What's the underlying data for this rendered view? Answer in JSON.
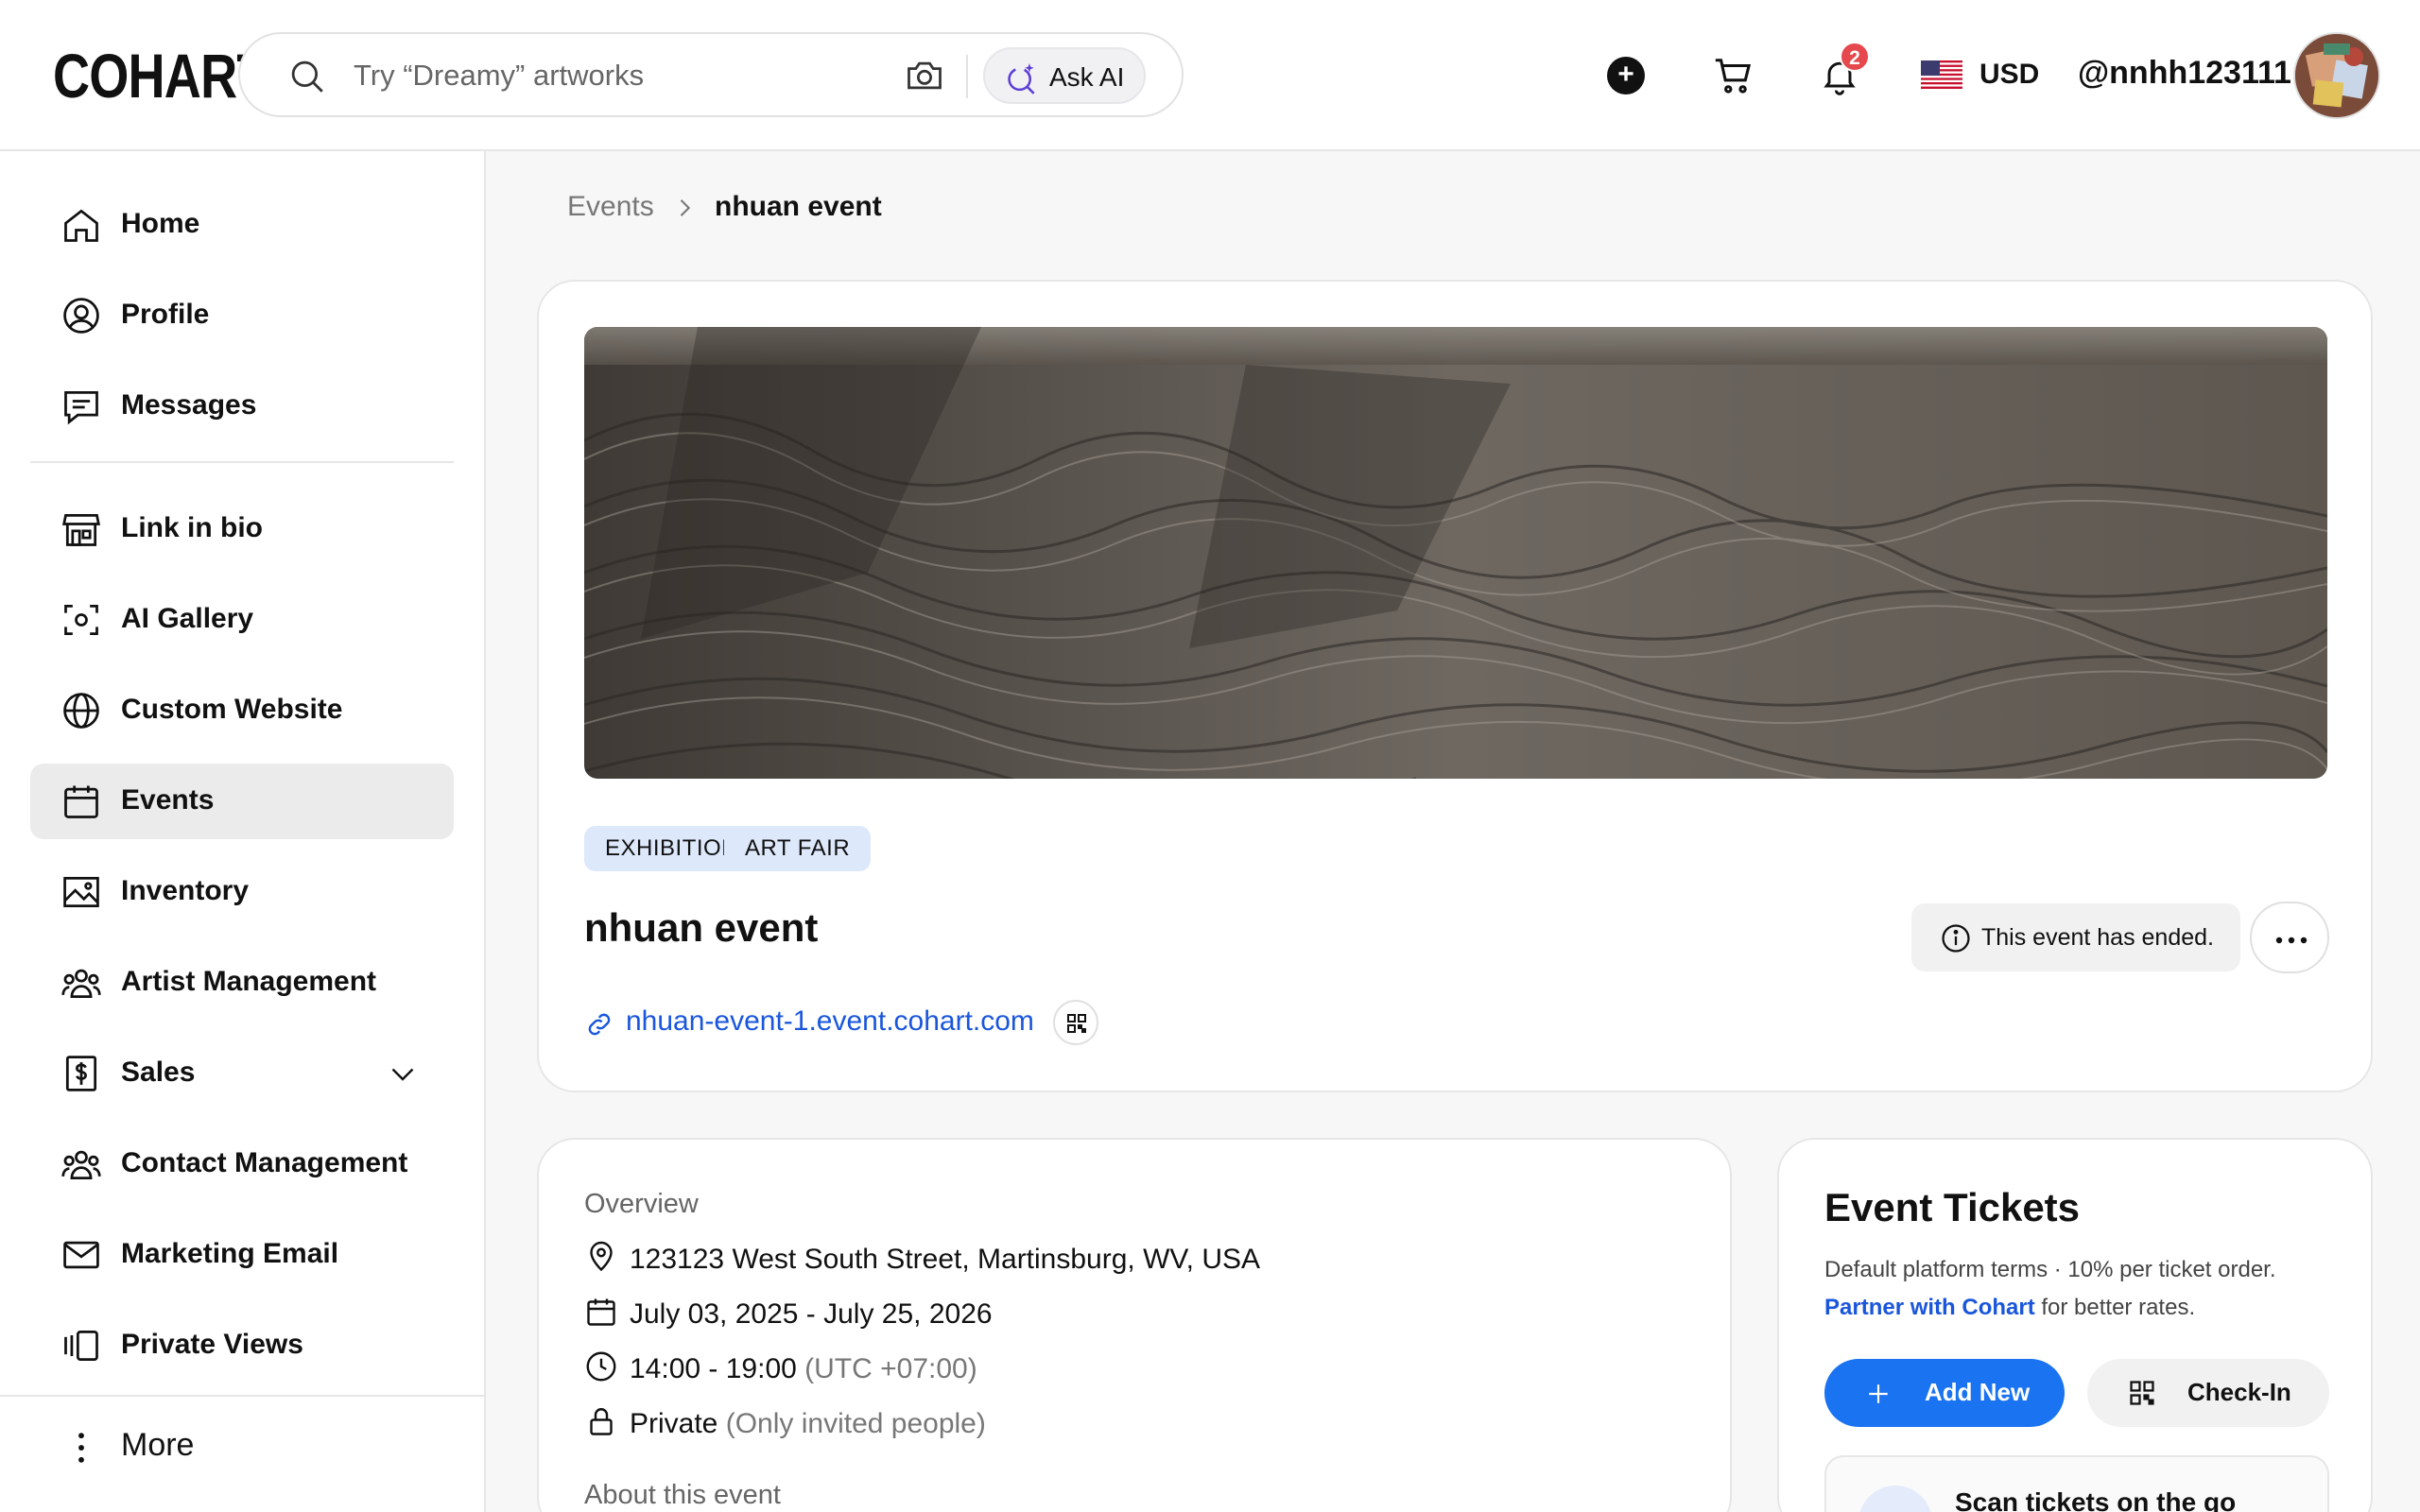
{
  "header": {
    "logo": "COHART",
    "search_placeholder": "Try “Dreamy” artworks",
    "ask_ai_label": "Ask AI",
    "notification_count": "2",
    "currency": "USD",
    "username": "@nnhh123111"
  },
  "sidebar": {
    "items": [
      {
        "label": "Home",
        "icon": "home-icon"
      },
      {
        "label": "Profile",
        "icon": "profile-icon"
      },
      {
        "label": "Messages",
        "icon": "messages-icon"
      },
      {
        "label": "Link in bio",
        "icon": "storefront-icon"
      },
      {
        "label": "AI Gallery",
        "icon": "scan-face-icon"
      },
      {
        "label": "Custom Website",
        "icon": "globe-icon"
      },
      {
        "label": "Events",
        "icon": "calendar-icon",
        "active": true
      },
      {
        "label": "Inventory",
        "icon": "image-icon"
      },
      {
        "label": "Artist Management",
        "icon": "users-icon"
      },
      {
        "label": "Sales",
        "icon": "dollar-icon"
      },
      {
        "label": "Contact Management",
        "icon": "contacts-icon"
      },
      {
        "label": "Marketing Email",
        "icon": "mail-icon"
      },
      {
        "label": "Private Views",
        "icon": "private-views-icon"
      }
    ],
    "more_label": "More"
  },
  "breadcrumb": {
    "parent": "Events",
    "current": "nhuan event"
  },
  "event": {
    "tags": [
      "EXHIBITION",
      "ART FAIR"
    ],
    "title": "nhuan event",
    "status": "This event has ended.",
    "link": "nhuan-event-1.event.cohart.com"
  },
  "overview": {
    "heading": "Overview",
    "address": "123123 West South Street, Martinsburg, WV, USA",
    "dates": "July 03, 2025 - July 25, 2026",
    "time": "14:00 - 19:00",
    "timezone": "(UTC +07:00)",
    "visibility": "Private",
    "visibility_note": "(Only invited people)",
    "about_heading": "About this event"
  },
  "tickets": {
    "title": "Event Tickets",
    "terms": "Default platform terms · 10% per ticket order.",
    "partner_link": "Partner with Cohart",
    "partner_rest": " for better rates.",
    "add_new_label": "Add New",
    "check_in_label": "Check-In",
    "scan_label": "Scan tickets on the go"
  },
  "colors": {
    "accent_blue": "#1a73f0",
    "link_blue": "#1a56db",
    "tag_bg": "#dde8fb",
    "badge_red": "#e5484d"
  }
}
